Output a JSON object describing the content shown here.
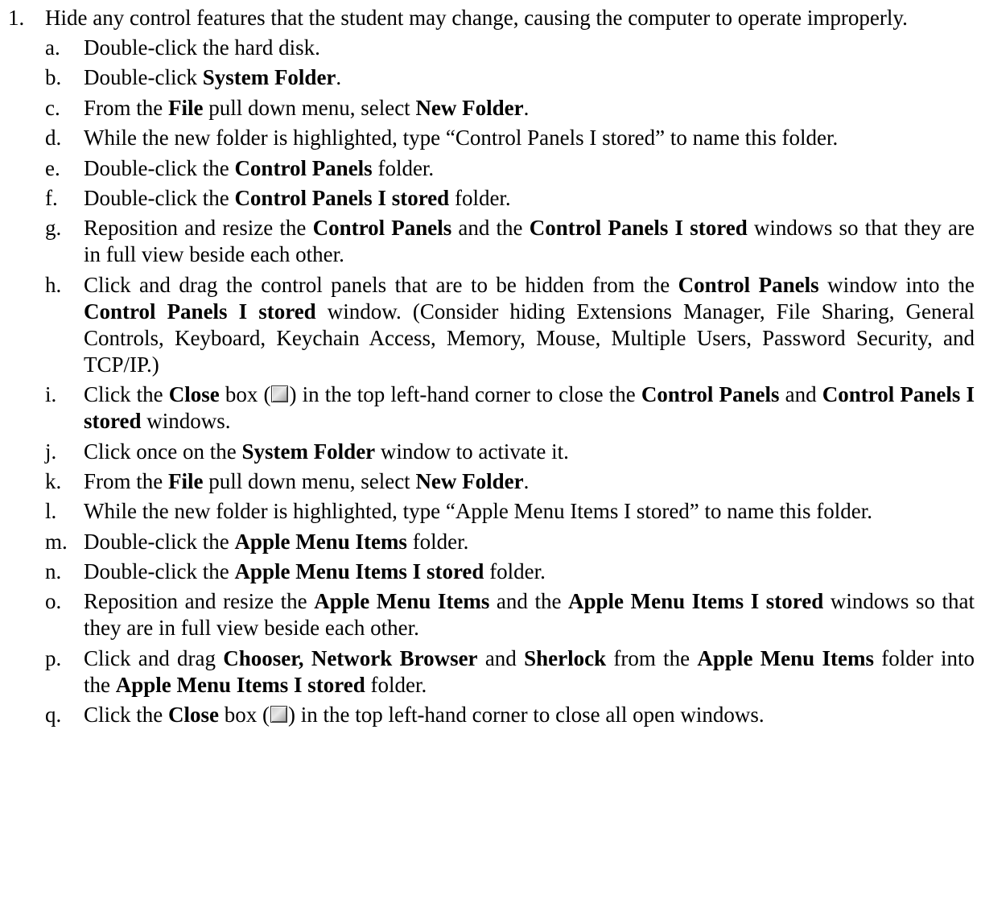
{
  "item": {
    "number": "1.",
    "text": "Hide any control features that the student may change, causing the computer to operate improperly."
  },
  "steps": {
    "a": {
      "label": "a.",
      "t1": "Double-click the hard disk."
    },
    "b": {
      "label": "b.",
      "t1": "Double-click ",
      "b1": "System Folder",
      "t2": "."
    },
    "c": {
      "label": "c.",
      "t1": "From the ",
      "b1": "File",
      "t2": " pull down menu, select ",
      "b2": "New Folder",
      "t3": "."
    },
    "d": {
      "label": "d.",
      "t1": "While the new folder is highlighted, type “Control  Panels I stored”  to  name this folder."
    },
    "e": {
      "label": "e.",
      "t1": "Double-click the ",
      "b1": "Control Panels",
      "t2": " folder."
    },
    "f": {
      "label": "f.",
      "t1": "Double-click the ",
      "b1": "Control Panels I stored",
      "t2": " folder."
    },
    "g": {
      "label": "g.",
      "t1": "Reposition and resize the ",
      "b1": "Control Panels",
      "t2": " and the ",
      "b2": "Control Panels I stored",
      "t3": " windows so that they are in full view beside each other."
    },
    "h": {
      "label": "h.",
      "t1": "Click and drag the control panels that are to be hidden from the ",
      "b1": "Control Panels",
      "t2": " window into the ",
      "b2": "Control Panels I stored",
      "t3": " window. (Consider hiding Extensions Manager, File Sharing, General Controls, Keyboard, Keychain Access, Memory, Mouse, Multiple Users, Password Security, and TCP/IP.)"
    },
    "i": {
      "label": "i.",
      "t1": "Click the ",
      "b1": "Close",
      "t2": " box (",
      "t3": ") in the top left-hand corner to close the ",
      "b2": "Control Panels",
      "t4": " and ",
      "b3": "Control Panels I stored",
      "t5": " windows."
    },
    "j": {
      "label": "j.",
      "t1": "Click once on the ",
      "b1": "System Folder",
      "t2": " window to activate it."
    },
    "k": {
      "label": "k.",
      "t1": "From the ",
      "b1": "File",
      "t2": " pull down menu, select ",
      "b2": "New Folder",
      "t3": "."
    },
    "l": {
      "label": "l.",
      "t1": "While the new folder is highlighted, type “Apple Menu Items I stored” to name this folder."
    },
    "m": {
      "label": "m.",
      "t1": "Double-click the ",
      "b1": "Apple Menu Items",
      "t2": " folder."
    },
    "n": {
      "label": "n.",
      "t1": "Double-click the ",
      "b1": "Apple Menu Items I stored",
      "t2": " folder."
    },
    "o": {
      "label": "o.",
      "t1": "Reposition and resize the ",
      "b1": "Apple Menu Items",
      "t2": " and the ",
      "b2": "Apple Menu Items I stored",
      "t3": " windows so that they are in full view beside each other."
    },
    "p": {
      "label": "p.",
      "t1": "Click and drag ",
      "b1": "Chooser, Network Browser",
      "t2": " and ",
      "b2": "Sherlock",
      "t3": " from the ",
      "b3": "Apple Menu Items",
      "t4": " folder into the ",
      "b4": "Apple Menu Items I stored",
      "t5": " folder."
    },
    "q": {
      "label": "q.",
      "t1": "Click the ",
      "b1": "Close",
      "t2": " box (",
      "t3": ") in the top left-hand corner to close all open windows."
    }
  },
  "icons": {
    "close_box": "close-box-icon"
  }
}
